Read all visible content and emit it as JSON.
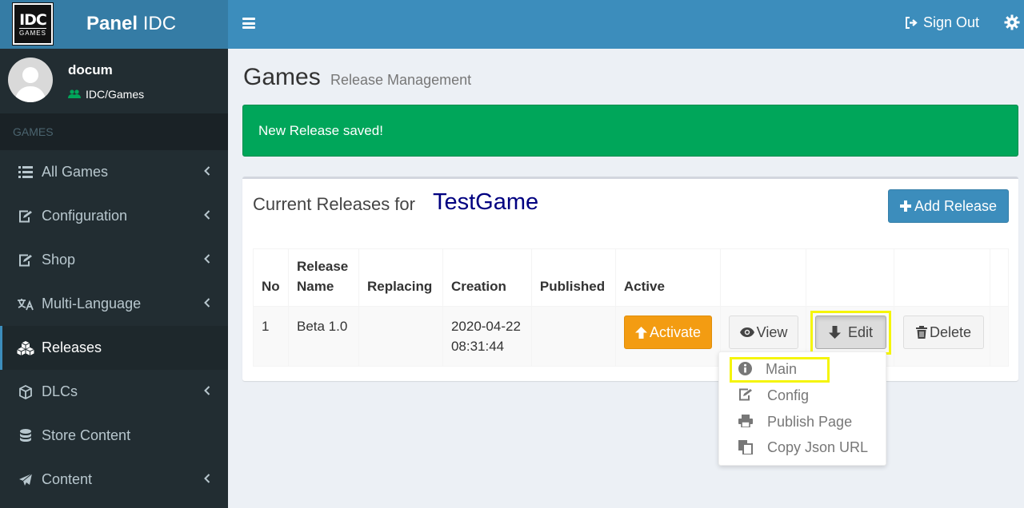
{
  "brand": {
    "badge_big": "IDC",
    "badge_small": "GAMES",
    "title_bold": "Panel",
    "title_rest": " IDC"
  },
  "navbar": {
    "signout_label": "Sign Out"
  },
  "user": {
    "name": "docum",
    "group": "IDC/Games"
  },
  "sidebar": {
    "header": "GAMES",
    "items": [
      {
        "label": "All Games",
        "icon": "list-icon",
        "chevron": true
      },
      {
        "label": "Configuration",
        "icon": "edit-icon",
        "chevron": true
      },
      {
        "label": "Shop",
        "icon": "edit-icon",
        "chevron": true
      },
      {
        "label": "Multi-Language",
        "icon": "language-icon",
        "chevron": true
      },
      {
        "label": "Releases",
        "icon": "cubes-icon",
        "chevron": false,
        "active": true
      },
      {
        "label": "DLCs",
        "icon": "cube-icon",
        "chevron": true
      },
      {
        "label": "Store Content",
        "icon": "database-icon",
        "chevron": false
      },
      {
        "label": "Content",
        "icon": "paper-plane-icon",
        "chevron": true
      }
    ]
  },
  "page": {
    "title": "Games",
    "subtitle": "Release Management"
  },
  "alert": {
    "message": "New Release saved!"
  },
  "box": {
    "title": "Current Releases for",
    "game": "TestGame",
    "add_label": "Add Release"
  },
  "table": {
    "headers": [
      "No",
      "Release Name",
      "Replacing",
      "Creation",
      "Published",
      "Active",
      "",
      "",
      "",
      ""
    ],
    "row": {
      "no": "1",
      "name": "Beta 1.0",
      "replacing": "",
      "creation_date": "2020-04-22",
      "creation_time": "08:31:44",
      "published": ""
    }
  },
  "actions": {
    "activate": "Activate",
    "view": "View",
    "edit": "Edit",
    "delete": "Delete"
  },
  "edit_menu": {
    "main": "Main",
    "config": "Config",
    "publish": "Publish Page",
    "copy": "Copy Json URL"
  },
  "colors": {
    "navbar": "#3c8dbc",
    "logo_bg": "#357ca5",
    "sidebar": "#222d32",
    "success": "#00a65a",
    "warning": "#f39c12",
    "highlight": "#f5f50a"
  }
}
